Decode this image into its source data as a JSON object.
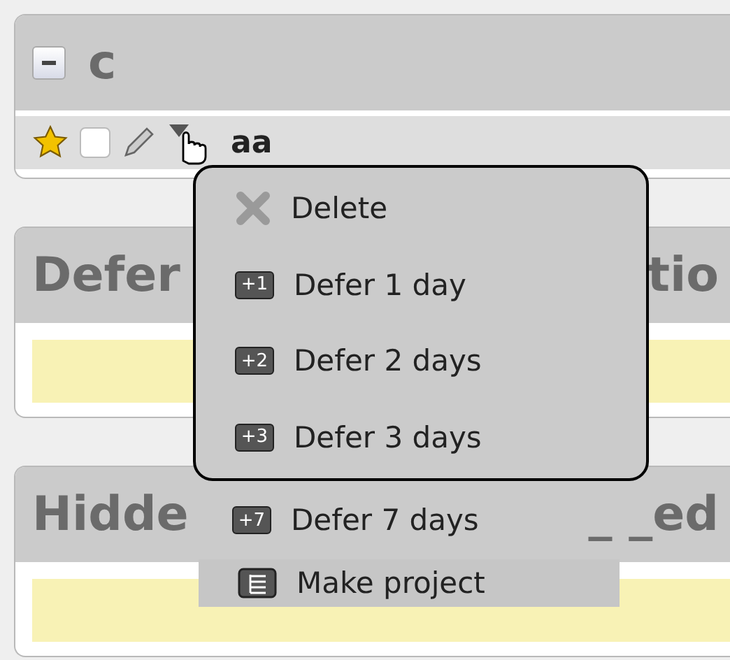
{
  "sections": [
    {
      "kind": "task",
      "title": "c",
      "collapsed": false,
      "task": {
        "flagged": true,
        "checked": false,
        "name": "aa"
      }
    },
    {
      "kind": "empty",
      "title_left": "Defer",
      "title_right": "tio"
    },
    {
      "kind": "empty",
      "title_left": "Hidde",
      "title_right": "_ _ed"
    }
  ],
  "menu": {
    "items": [
      {
        "kind": "delete",
        "label": "Delete",
        "framed": true
      },
      {
        "kind": "badge",
        "badge": "+1",
        "label": "Defer 1 day",
        "framed": true
      },
      {
        "kind": "badge",
        "badge": "+2",
        "label": "Defer 2 days",
        "framed": true
      },
      {
        "kind": "badge",
        "badge": "+3",
        "label": "Defer 3 days",
        "framed": true
      },
      {
        "kind": "badge",
        "badge": "+7",
        "label": "Defer 7 days",
        "framed": false
      },
      {
        "kind": "project",
        "label": "Make project",
        "framed": false,
        "selected": true
      }
    ]
  }
}
